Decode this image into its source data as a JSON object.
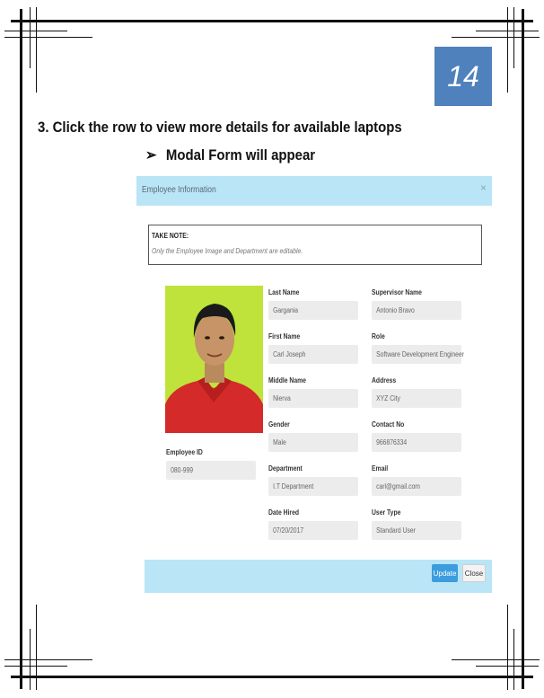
{
  "page_number": "14",
  "instruction": "3. Click the row to view more details for available laptops",
  "sub_instruction": "Modal Form will appear",
  "modal": {
    "title": "Employee Information",
    "close_symbol": "×",
    "note_title": "TAKE NOTE:",
    "note_text": "Only the Employee Image and Department are editable.",
    "employee_id_label": "Employee ID",
    "employee_id_value": "080-999",
    "fields": {
      "last_name": {
        "label": "Last Name",
        "value": "Gargania"
      },
      "first_name": {
        "label": "First Name",
        "value": "Carl Joseph"
      },
      "middle_name": {
        "label": "Middle Name",
        "value": "Nierva"
      },
      "gender": {
        "label": "Gender",
        "value": "Male"
      },
      "department": {
        "label": "Department",
        "value": "I.T Department"
      },
      "date_hired": {
        "label": "Date Hired",
        "value": "07/20/2017"
      },
      "supervisor_name": {
        "label": "Supervisor Name",
        "value": "Antonio Bravo"
      },
      "role": {
        "label": "Role",
        "value": "Software Development Engineer"
      },
      "address": {
        "label": "Address",
        "value": "XYZ City"
      },
      "contact_no": {
        "label": "Contact No",
        "value": "966876334"
      },
      "email": {
        "label": "Email",
        "value": "carl@gmail.com"
      },
      "user_type": {
        "label": "User Type",
        "value": "Standard User"
      }
    },
    "update_label": "Update",
    "close_label": "Close"
  },
  "colors": {
    "page_badge": "#4f81bd",
    "modal_header": "#b9e5f7",
    "photo_background": "#bfe33a",
    "shirt": "#d42a2a",
    "update_button": "#3b9ddd"
  }
}
